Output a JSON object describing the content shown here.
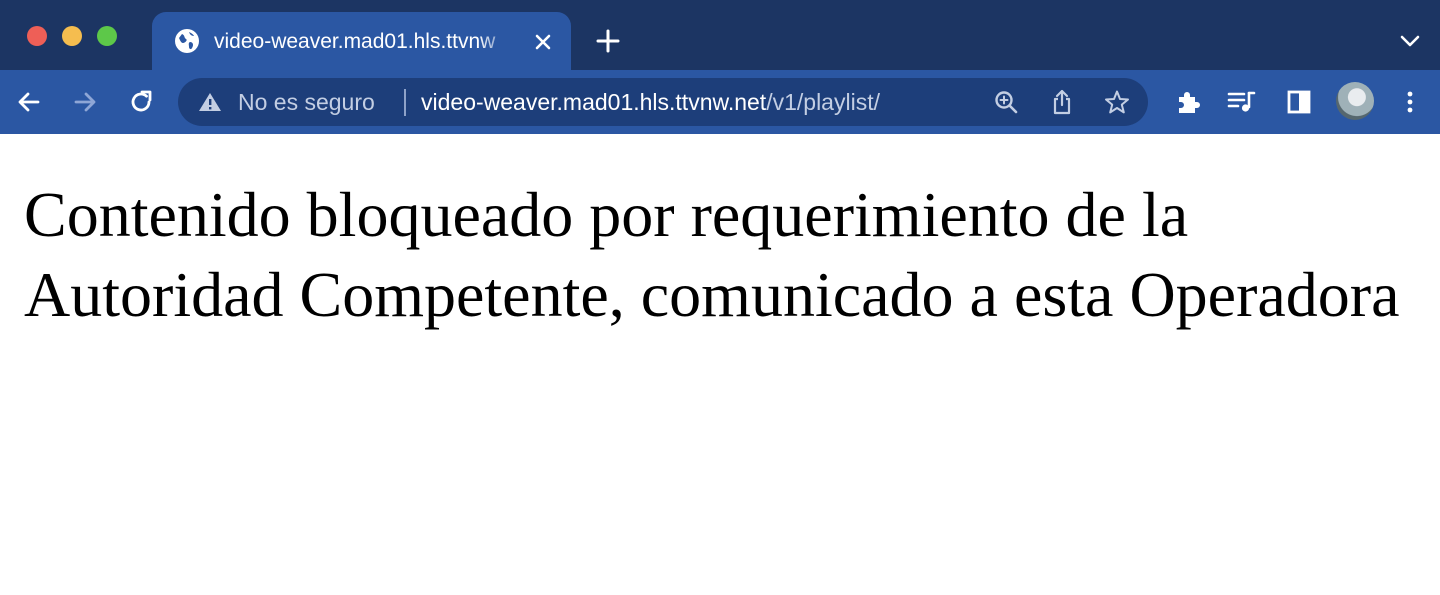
{
  "browser": {
    "tab": {
      "title": "video-weaver.mad01.hls.ttvnw"
    },
    "address_bar": {
      "security_label": "No es seguro",
      "url_host": "video-weaver.mad01.hls.ttvnw.net",
      "url_path": "/v1/playlist/"
    },
    "colors": {
      "titlebar": "#1c3563",
      "toolbar": "#2b57a3",
      "omnibox": "#1d3e7a"
    }
  },
  "page": {
    "message": "Contenido bloqueado por requerimiento de la Autoridad Competente, comunicado a esta Operadora"
  }
}
